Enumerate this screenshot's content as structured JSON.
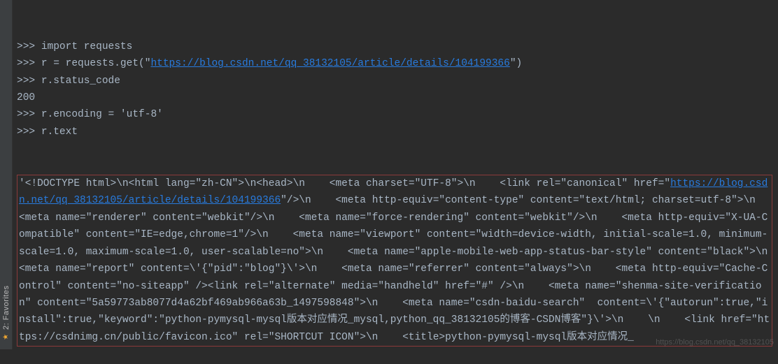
{
  "sidebar": {
    "favorites_label": "2: Favorites"
  },
  "repl": {
    "lines": [
      {
        "prompt": ">>> ",
        "segments": [
          {
            "t": "import requests",
            "cls": "plain"
          }
        ]
      },
      {
        "prompt": ">>> ",
        "segments": [
          {
            "t": "r = requests.get(\"",
            "cls": "plain"
          },
          {
            "t": "https://blog.csdn.net/qq_38132105/article/details/104199366",
            "cls": "link"
          },
          {
            "t": "\")",
            "cls": "plain"
          }
        ]
      },
      {
        "prompt": ">>> ",
        "segments": [
          {
            "t": "r.status_code",
            "cls": "plain"
          }
        ]
      },
      {
        "prompt": "",
        "segments": [
          {
            "t": "200",
            "cls": "plain"
          }
        ]
      },
      {
        "prompt": ">>> ",
        "segments": [
          {
            "t": "r.encoding = 'utf-8'",
            "cls": "plain"
          }
        ]
      },
      {
        "prompt": ">>> ",
        "segments": [
          {
            "t": "r.text",
            "cls": "plain"
          }
        ]
      }
    ],
    "output": {
      "segments": [
        {
          "t": "'<!DOCTYPE html>\\n<html lang=\"zh-CN\">\\n<head>\\n    <meta charset=\"UTF-8\">\\n    <link rel=\"canonical\" href=\"",
          "cls": "plain"
        },
        {
          "t": "https://blog.csdn.net/qq_38132105/article/details/104199366",
          "cls": "link"
        },
        {
          "t": "\"/>\\n    <meta http-equiv=\"content-type\" content=\"text/html; charset=utf-8\">\\n    <meta name=\"renderer\" content=\"webkit\"/>\\n    <meta name=\"force-rendering\" content=\"webkit\"/>\\n    <meta http-equiv=\"X-UA-Compatible\" content=\"IE=edge,chrome=1\"/>\\n    <meta name=\"viewport\" content=\"width=device-width, initial-scale=1.0, minimum-scale=1.0, maximum-scale=1.0, user-scalable=no\">\\n    <meta name=\"apple-mobile-web-app-status-bar-style\" content=\"black\">\\n    <meta name=\"report\" content=\\'{\"pid\":\"blog\"}\\'>\\n    <meta name=\"referrer\" content=\"always\">\\n    <meta http-equiv=\"Cache-Control\" content=\"no-siteapp\" /><link rel=\"alternate\" media=\"handheld\" href=\"#\" />\\n    <meta name=\"shenma-site-verification\" content=\"5a59773ab8077d4a62bf469ab966a63b_1497598848\">\\n    <meta name=\"csdn-baidu-search\"  content=\\'{\"autorun\":true,\"install\":true,\"keyword\":\"python-pymysql-mysql版本对应情况_mysql,python_qq_38132105的博客-CSDN博客\"}\\'>\\n    \\n    <link href=\"https://csdnimg.cn/public/favicon.ico\" rel=\"SHORTCUT ICON\">\\n    <title>python-pymysql-mysql版本对应情况_",
          "cls": "plain"
        }
      ]
    }
  },
  "watermark": "https://blog.csdn.net/qq_38132105"
}
